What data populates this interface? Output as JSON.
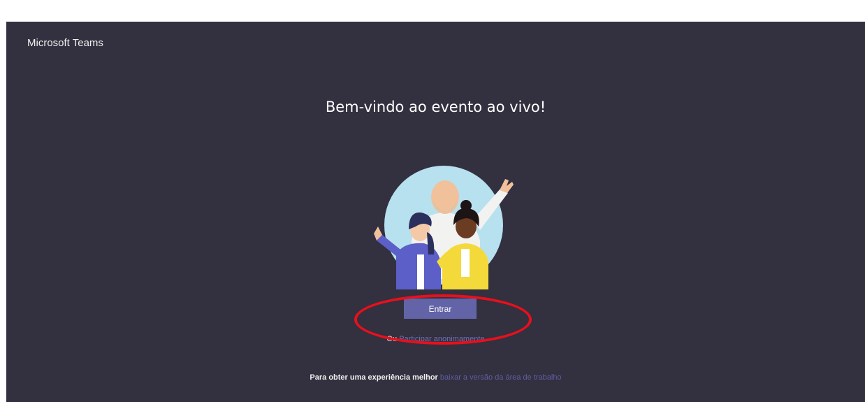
{
  "app": {
    "title": "Microsoft Teams"
  },
  "main": {
    "welcome": "Bem-vindo ao evento ao vivo!",
    "join_label": "Entrar",
    "alt_prefix": "Ou",
    "anon_link": "Participar anonimamente",
    "footer_lead": "Para obter uma experiência melhor",
    "footer_link": "baixar a versão da área de trabalho"
  },
  "colors": {
    "background": "#33303f",
    "accent": "#6264a7",
    "highlight": "#e8101c"
  },
  "icons": {
    "illustration": "welcome-people-illustration"
  }
}
